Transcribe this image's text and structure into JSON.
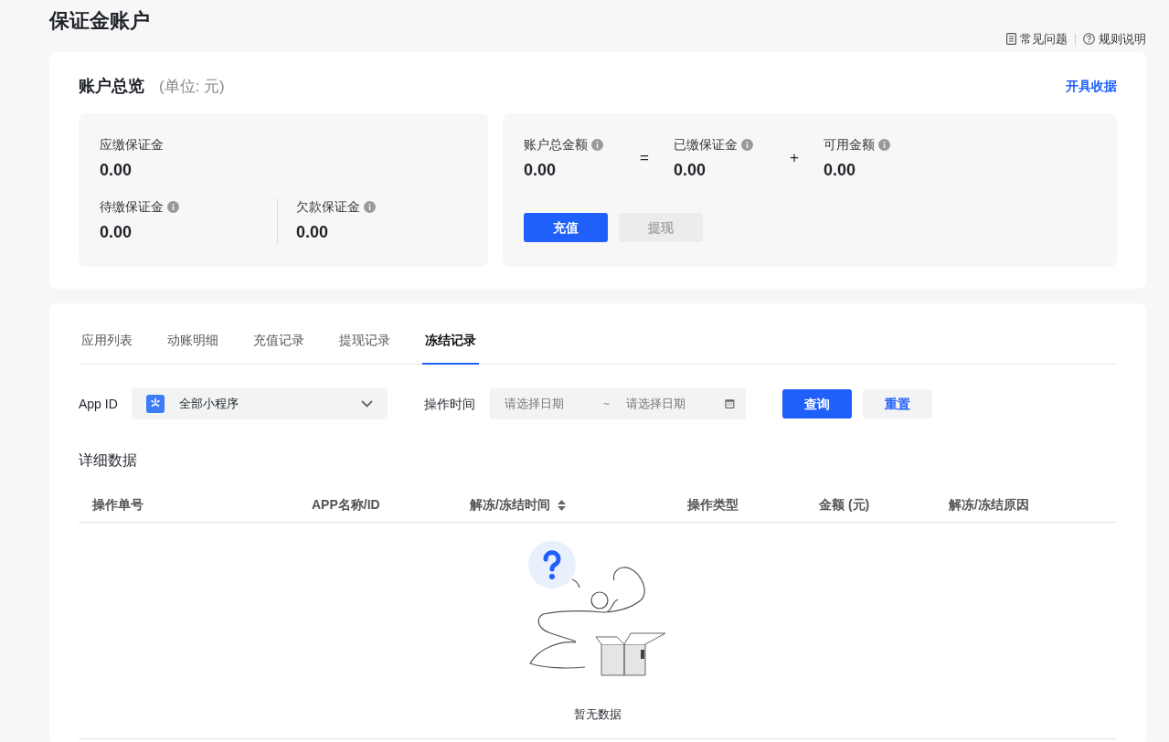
{
  "page_title": "保证金账户",
  "header_links": [
    {
      "label": "常见问题"
    },
    {
      "label": "规则说明"
    }
  ],
  "overview": {
    "title": "账户总览",
    "unit": "(单位: 元)",
    "action": "开具收据",
    "due": {
      "label": "应缴保证金",
      "value": "0.00"
    },
    "sub_items": [
      {
        "label": "待缴保证金",
        "info": true,
        "value": "0.00"
      },
      {
        "label": "欠款保证金",
        "info": true,
        "value": "0.00"
      }
    ],
    "formula": [
      {
        "kind": "term",
        "label": "账户总金额",
        "info": true,
        "value": "0.00"
      },
      {
        "kind": "operator",
        "symbol": "="
      },
      {
        "kind": "term",
        "label": "已缴保证金",
        "info": true,
        "value": "0.00"
      },
      {
        "kind": "operator",
        "symbol": "+"
      },
      {
        "kind": "term",
        "label": "可用金额",
        "info": true,
        "value": "0.00"
      }
    ],
    "buttons": [
      {
        "label": "充值",
        "disabled": false
      },
      {
        "label": "提现",
        "disabled": true
      }
    ]
  },
  "tabs": [
    {
      "label": "应用列表",
      "selected": false
    },
    {
      "label": "动账明细",
      "selected": false
    },
    {
      "label": "充值记录",
      "selected": false
    },
    {
      "label": "提现记录",
      "selected": false
    },
    {
      "label": "冻结记录",
      "selected": true
    }
  ],
  "filters": {
    "app_label": "App ID",
    "app_select": "全部小程序",
    "time_label": "操作时间",
    "start_placeholder": "请选择日期",
    "separator": "~",
    "end_placeholder": "请选择日期",
    "buttons": [
      {
        "label": "查询",
        "kind": "primary"
      },
      {
        "label": "重置",
        "kind": "secondary"
      }
    ]
  },
  "section_title": "详细数据",
  "table": {
    "columns": [
      {
        "label": "操作单号",
        "sortable": false
      },
      {
        "label": "APP名称/ID",
        "sortable": false
      },
      {
        "label": "解冻/冻结时间",
        "sortable": true
      },
      {
        "label": "操作类型",
        "sortable": false
      },
      {
        "label": "金额 (元)",
        "sortable": false
      },
      {
        "label": "解冻/冻结原因",
        "sortable": false
      }
    ],
    "empty_text": "暂无数据"
  }
}
